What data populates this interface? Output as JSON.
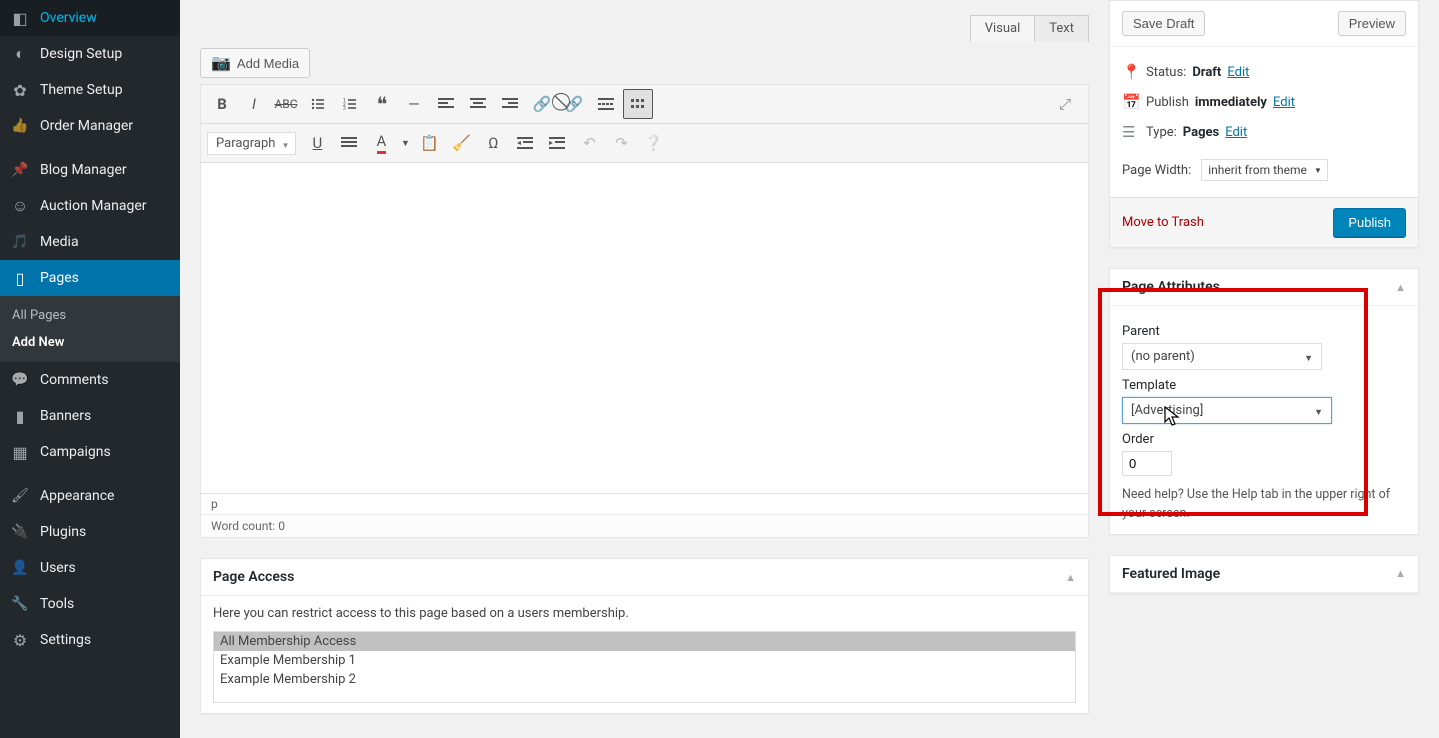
{
  "sidebar": {
    "items": [
      {
        "label": "Overview",
        "icon": "i-overview"
      },
      {
        "label": "Design Setup",
        "icon": "i-design"
      },
      {
        "label": "Theme Setup",
        "icon": "i-theme"
      },
      {
        "label": "Order Manager",
        "icon": "i-order"
      },
      {
        "label": "Blog Manager",
        "icon": "i-blog"
      },
      {
        "label": "Auction Manager",
        "icon": "i-auction"
      },
      {
        "label": "Media",
        "icon": "i-media"
      },
      {
        "label": "Pages",
        "icon": "i-pages"
      },
      {
        "label": "Comments",
        "icon": "i-comments"
      },
      {
        "label": "Banners",
        "icon": "i-banners"
      },
      {
        "label": "Campaigns",
        "icon": "i-campaigns"
      },
      {
        "label": "Appearance",
        "icon": "i-appearance"
      },
      {
        "label": "Plugins",
        "icon": "i-plugins"
      },
      {
        "label": "Users",
        "icon": "i-users"
      },
      {
        "label": "Tools",
        "icon": "i-tools"
      },
      {
        "label": "Settings",
        "icon": "i-settings"
      }
    ],
    "submenu": {
      "all": "All Pages",
      "add": "Add New"
    }
  },
  "editor": {
    "add_media": "Add Media",
    "tab_visual": "Visual",
    "tab_text": "Text",
    "format": "Paragraph",
    "path": "p",
    "wordcount_label": "Word count: ",
    "wordcount": "0"
  },
  "publish": {
    "save_draft": "Save Draft",
    "preview": "Preview",
    "status_label": "Status: ",
    "status_value": "Draft",
    "publish_label": "Publish ",
    "publish_value": "immediately",
    "type_label": "Type: ",
    "type_value": "Pages",
    "edit_link": "Edit",
    "page_width_label": "Page Width:",
    "page_width_value": "inherit from theme",
    "trash": "Move to Trash",
    "publish_btn": "Publish"
  },
  "attributes": {
    "title": "Page Attributes",
    "parent_label": "Parent",
    "parent_value": "(no parent)",
    "template_label": "Template",
    "template_value": "[Advertising]",
    "order_label": "Order",
    "order_value": "0",
    "help": "Need help? Use the Help tab in the upper right of your screen."
  },
  "featured": {
    "title": "Featured Image"
  },
  "page_access": {
    "title": "Page Access",
    "desc": "Here you can restrict access to this page based on a users membership.",
    "options": [
      "All Membership Access",
      "Example Membership 1",
      "Example Membership 2"
    ]
  }
}
